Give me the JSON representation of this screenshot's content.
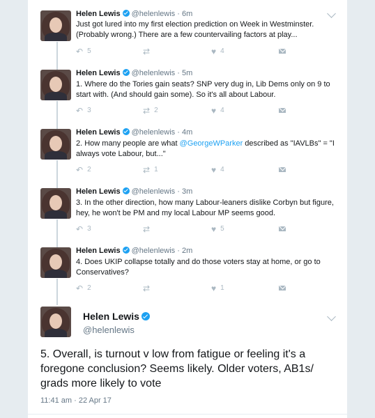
{
  "thread": [
    {
      "name": "Helen Lewis",
      "handle": "@helenlewis",
      "time": "6m",
      "text": "Just got lured into my first election prediction on Week in Westminster. (Probably wrong.) There are a few countervailing factors at play...",
      "counts": {
        "reply": "5",
        "retweet": "",
        "like": "4"
      }
    },
    {
      "name": "Helen Lewis",
      "handle": "@helenlewis",
      "time": "5m",
      "text": "1. Where do the Tories gain seats? SNP very dug in, Lib Dems only on 9 to start with. (And should gain some).  So it's all about Labour.",
      "counts": {
        "reply": "3",
        "retweet": "2",
        "like": "4"
      }
    },
    {
      "name": "Helen Lewis",
      "handle": "@helenlewis",
      "time": "4m",
      "text_before": "2. How many people are what ",
      "mention": "@GeorgeWParker",
      "text_after": " described as \"IAVLBs\" = \"I always vote Labour, but...\"",
      "counts": {
        "reply": "2",
        "retweet": "1",
        "like": "4"
      }
    },
    {
      "name": "Helen Lewis",
      "handle": "@helenlewis",
      "time": "3m",
      "text": "3. In the other direction, how many Labour-leaners dislike Corbyn but figure, hey, he won't be PM and my local Labour MP seems good.",
      "counts": {
        "reply": "3",
        "retweet": "",
        "like": "5"
      }
    },
    {
      "name": "Helen Lewis",
      "handle": "@helenlewis",
      "time": "2m",
      "text": "4. Does UKIP collapse totally and do those voters stay at home, or go to Conservatives?",
      "counts": {
        "reply": "2",
        "retweet": "",
        "like": "1"
      }
    }
  ],
  "main_tweet": {
    "name": "Helen Lewis",
    "handle": "@helenlewis",
    "text": "5.  Overall, is turnout v low from fatigue or feeling it's a foregone conclusion? Seems likely. Older voters, AB1s/ grads more likely to vote",
    "timestamp": "11:41 am · 22 Apr 17"
  },
  "separator": " · ",
  "icons": {
    "reply": "↶",
    "retweet": "⇄",
    "like": "♥"
  },
  "colors": {
    "accent": "#1da1f2",
    "text": "#14171a",
    "muted": "#657786",
    "icon": "#aab8c2",
    "background": "#e6ecf0"
  }
}
